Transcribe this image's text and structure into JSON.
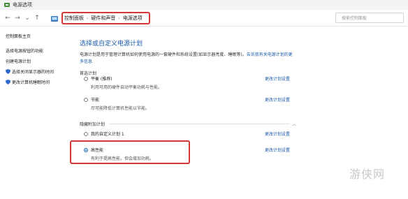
{
  "window": {
    "title": "电源选项"
  },
  "address": {
    "back_icon": "←",
    "forward_icon": "→",
    "dropdown_icon": "⌄",
    "up_icon": "↑",
    "breadcrumbs": [
      "控制面板",
      "硬件和声音",
      "电源选项"
    ],
    "separator": "›",
    "search_placeholder": "搜索控制面板"
  },
  "sidebar": {
    "home": "控制面板主页",
    "links": [
      "选择电源按钮的功能",
      "创建电源计划",
      "选择关闭显示器的时间",
      "更改计算机睡眠时间"
    ]
  },
  "main": {
    "heading": "选择或自定义电源计划",
    "description": "电源计划是用于管理计算机如何使用电源的一套硬件和系统设置(如显示器亮度、睡眠等)。",
    "description_link": "告诉我有关电源计划的更多信息",
    "preferred_label": "首选计划",
    "hidden_label": "隐藏附加计划",
    "change_link": "更改计划设置",
    "plans": [
      {
        "name": "平衡 (推荐)",
        "desc": "利用可用的硬件自动平衡功耗与性能。",
        "selected": false
      },
      {
        "name": "节能",
        "desc": "尽可能降低计算机性能以节能。",
        "selected": false
      },
      {
        "name": "我的自定义计划 1",
        "desc": "",
        "selected": false
      },
      {
        "name": "高性能",
        "desc": "有利于提高性能，但会增加功耗。",
        "selected": true
      }
    ]
  },
  "watermark": "游侠网",
  "colors": {
    "accent": "#1a66c4",
    "link": "#1c5aa6",
    "highlight_box": "#d63636"
  }
}
